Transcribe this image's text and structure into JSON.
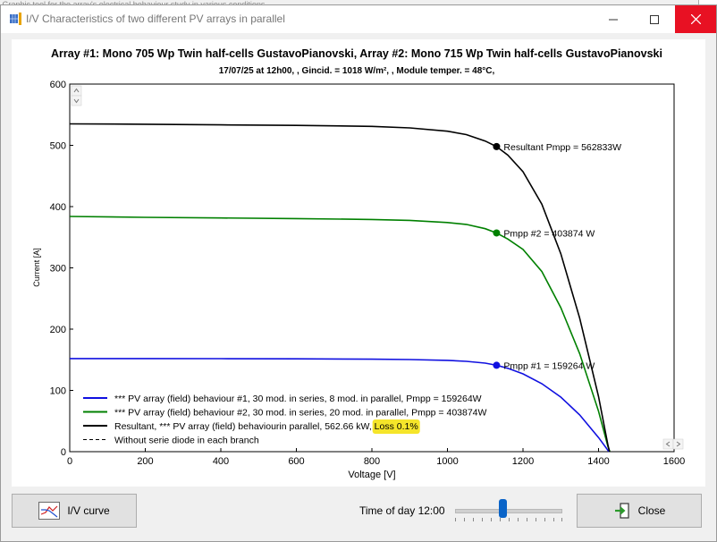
{
  "window": {
    "title": "I/V Characteristics of two different PV arrays in parallel",
    "background_text": "Graphic tool for the array's electrical behaviour study in various conditions"
  },
  "plot": {
    "title": "Array #1: Mono 705 Wp Twin half-cells GustavoPianovski, Array #2: Mono 715 Wp Twin half-cells GustavoPianovski",
    "subtitle": "17/07/25 at 12h00, , Gincid. = 1018 W/m², , Module temper. = 48°C,",
    "xlabel": "Voltage [V]",
    "ylabel": "Current [A]"
  },
  "chart_data": {
    "type": "line",
    "xlim": [
      0,
      1600
    ],
    "ylim": [
      0,
      600
    ],
    "x_ticks": [
      0,
      200,
      400,
      600,
      800,
      1000,
      1200,
      1400,
      1600
    ],
    "y_ticks": [
      0,
      100,
      200,
      300,
      400,
      500,
      600
    ],
    "grid": false,
    "legend_position": "bottom-left",
    "series": [
      {
        "name": "*** PV array (field) behaviour #1, 30 mod. in series, 8 mod. in parallel, Pmpp = 159264W",
        "color": "#1010e0",
        "points": [
          [
            0,
            152
          ],
          [
            200,
            152
          ],
          [
            400,
            151.8
          ],
          [
            600,
            151.5
          ],
          [
            800,
            151
          ],
          [
            900,
            150.3
          ],
          [
            1000,
            149
          ],
          [
            1050,
            147.5
          ],
          [
            1100,
            144.5
          ],
          [
            1130,
            141
          ],
          [
            1160,
            136
          ],
          [
            1200,
            127
          ],
          [
            1250,
            111
          ],
          [
            1300,
            89
          ],
          [
            1350,
            60
          ],
          [
            1400,
            23
          ],
          [
            1425,
            2
          ],
          [
            1428,
            0
          ]
        ],
        "mpp": {
          "v": 1130,
          "i": 141,
          "label": "Pmpp #1 = 159264 W"
        }
      },
      {
        "name": "*** PV array (field) behaviour #2, 30 mod. in series, 20 mod. in parallel, Pmpp = 403874W",
        "color": "#008000",
        "points": [
          [
            0,
            384
          ],
          [
            200,
            382.5
          ],
          [
            400,
            381.5
          ],
          [
            600,
            380.5
          ],
          [
            800,
            379
          ],
          [
            900,
            377.5
          ],
          [
            1000,
            374
          ],
          [
            1050,
            371
          ],
          [
            1100,
            364
          ],
          [
            1130,
            357
          ],
          [
            1160,
            347
          ],
          [
            1200,
            330
          ],
          [
            1250,
            294
          ],
          [
            1300,
            235
          ],
          [
            1350,
            160
          ],
          [
            1400,
            66
          ],
          [
            1425,
            8
          ],
          [
            1430,
            0
          ]
        ],
        "mpp": {
          "v": 1130,
          "i": 357,
          "label": "Pmpp #2 = 403874 W"
        }
      },
      {
        "name": "Resultant, *** PV array (field) behaviourin parallel, 562.66 kW, ",
        "highlight": "Loss 0.1%",
        "color": "#000000",
        "points": [
          [
            0,
            535
          ],
          [
            200,
            534.5
          ],
          [
            400,
            533.5
          ],
          [
            600,
            532.5
          ],
          [
            800,
            531
          ],
          [
            900,
            528.5
          ],
          [
            1000,
            523
          ],
          [
            1050,
            517.5
          ],
          [
            1100,
            507
          ],
          [
            1130,
            498
          ],
          [
            1160,
            484
          ],
          [
            1200,
            457
          ],
          [
            1250,
            404
          ],
          [
            1300,
            323
          ],
          [
            1350,
            218
          ],
          [
            1400,
            90
          ],
          [
            1425,
            10
          ],
          [
            1429,
            0
          ]
        ],
        "mpp": {
          "v": 1130,
          "i": 498,
          "label": "Resultant Pmpp = 562833W"
        }
      },
      {
        "name": "Without serie diode in each branch",
        "color": "#000000",
        "dashed": true,
        "points": []
      }
    ]
  },
  "controls": {
    "iv_curve_label": "I/V curve",
    "time_of_day_label": "Time of day 12:00",
    "time_value": 12,
    "time_range": [
      0,
      24
    ],
    "close_label": "Close"
  }
}
